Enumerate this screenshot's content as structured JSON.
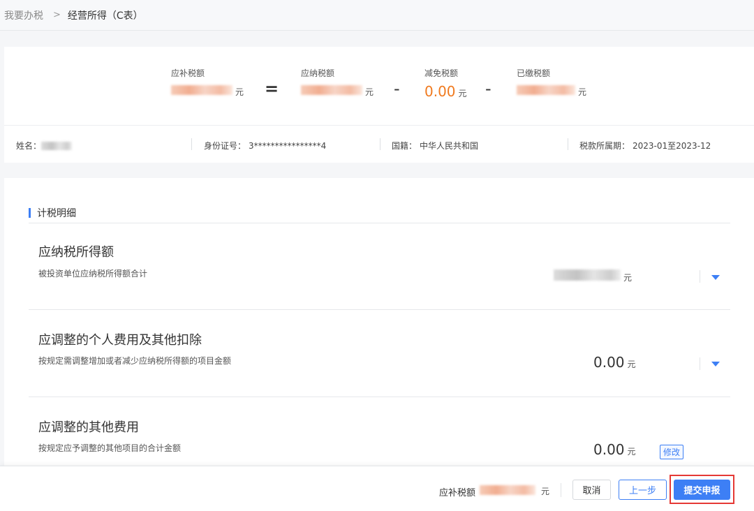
{
  "breadcrumb": {
    "parent": "我要办税",
    "separator": ">",
    "current": "经营所得（C表）"
  },
  "summary": {
    "payable_refund": {
      "label": "应补税额",
      "unit": "元"
    },
    "equals": "=",
    "tax_payable": {
      "label": "应纳税额",
      "unit": "元"
    },
    "minus_1": "-",
    "tax_relief": {
      "label": "减免税额",
      "value": "0.00",
      "unit": "元"
    },
    "minus_2": "-",
    "tax_paid": {
      "label": "已缴税额",
      "unit": "元"
    }
  },
  "info": {
    "name_label": "姓名：",
    "id_label": "身份证号：",
    "id_value": "3****************4",
    "nationality_label": "国籍：",
    "nationality_value": "中华人民共和国",
    "period_label": "税款所属期：",
    "period_value": "2023-01至2023-12"
  },
  "detail": {
    "section_title": "计税明细",
    "rows": [
      {
        "title": "应纳税所得额",
        "desc": "被投资单位应纳税所得额合计",
        "unit": "元"
      },
      {
        "title": "应调整的个人费用及其他扣除",
        "desc": "按规定需调整增加或者减少应纳税所得额的项目金额",
        "value": "0.00",
        "unit": "元"
      },
      {
        "title": "应调整的其他费用",
        "desc": "按规定应予调整的其他项目的合计金额",
        "value": "0.00",
        "unit": "元",
        "action": "修改"
      }
    ]
  },
  "footer": {
    "label": "应补税额",
    "unit": "元",
    "cancel": "取消",
    "prev": "上一步",
    "submit": "提交申报"
  },
  "colors": {
    "accent": "#3d7ff5",
    "orange": "#f07a1f",
    "highlight": "#e53935"
  },
  "icons": {
    "dropdown": "caret-down-icon"
  }
}
